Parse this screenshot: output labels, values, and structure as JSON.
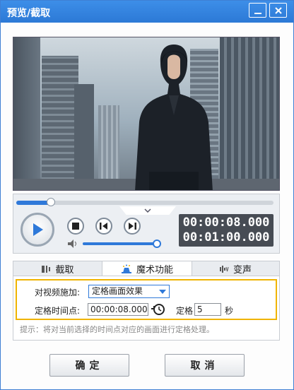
{
  "window": {
    "title": "预览/截取",
    "minimize_icon": "minimize-icon",
    "close_icon": "close-icon"
  },
  "player": {
    "progress_fraction": 0.135,
    "volume_fraction": 0.95,
    "current_time": "00:00:08.000",
    "total_time": "00:01:00.000"
  },
  "tabs": [
    {
      "label": "截取",
      "icon": "crop-icon"
    },
    {
      "label": "魔术功能",
      "icon": "magic-hat-icon"
    },
    {
      "label": "变声",
      "icon": "waveform-icon"
    }
  ],
  "magic": {
    "effect_label": "对视频施加:",
    "effect_value": "定格画面效果",
    "time_label": "定格时间点:",
    "time_value": "00:00:08.000",
    "freeze_label": "定格",
    "freeze_value": "5",
    "freeze_unit": "秒"
  },
  "hint": "提示：将对当前选择的时间点对应的画面进行定格处理。",
  "buttons": {
    "ok": "确定",
    "cancel": "取消"
  },
  "colors": {
    "accent": "#2f79d9",
    "highlight_border": "#f0b400",
    "titlebar": "#2c79d6"
  }
}
